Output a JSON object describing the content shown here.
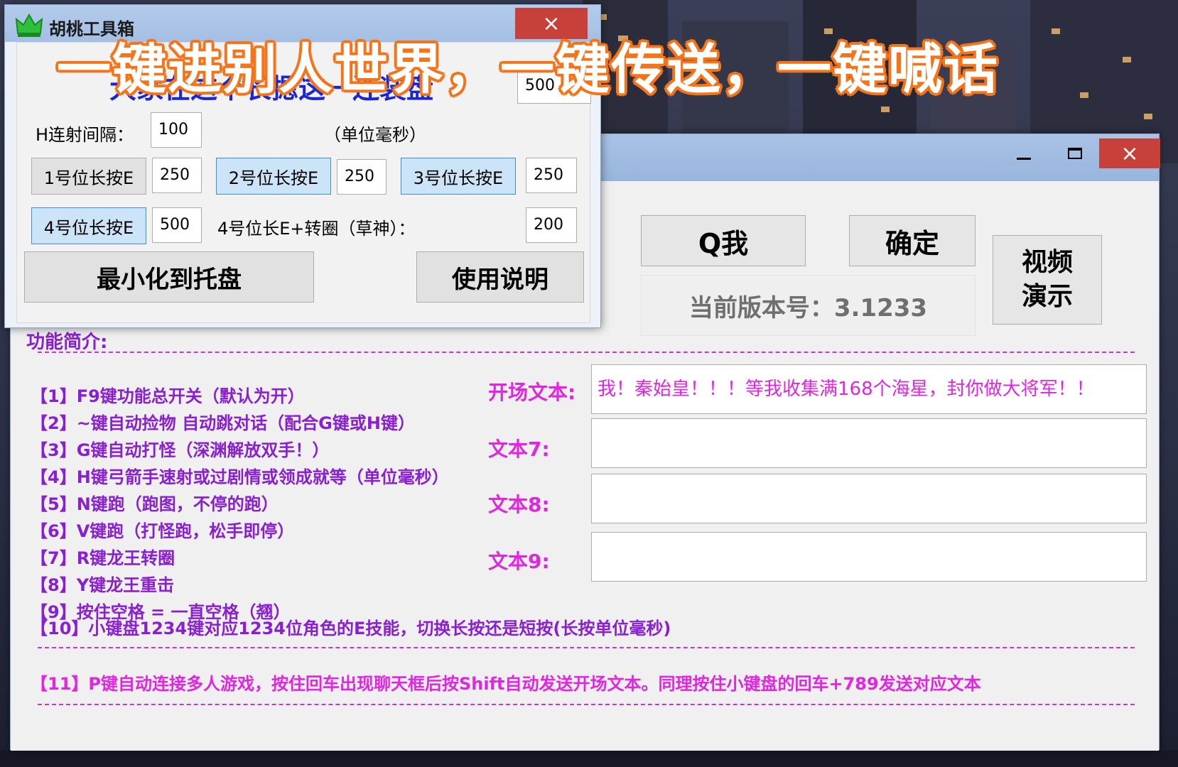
{
  "main_window": {
    "buttons": {
      "q_label": "Q我",
      "ok_label": "确定",
      "video_line1": "视频",
      "video_line2": "演示"
    },
    "version_text": "当前版本号：3.1233",
    "features_label": "功能简介:",
    "features": [
      "【1】F9键功能总开关（默认为开）",
      "【2】~键自动捡物 自动跳对话（配合G键或H键）",
      "【3】G键自动打怪（深渊解放双手！）",
      "【4】H键弓箭手速射或过剧情或领成就等（单位毫秒）",
      "【5】N键跑（跑图，不停的跑）",
      "【6】V键跑（打怪跑，松手即停）",
      "【7】R键龙王转圈",
      "【8】Y键龙王重击",
      "【9】按住空格 = 一直空格（翘）"
    ],
    "feature_10": "【10】小键盘1234键对应1234位角色的E技能，切换长按还是短按(长按单位毫秒)",
    "feature_11": "【11】P键自动连接多人游戏，按住回车出现聊天框后按Shift自动发送开场文本。同理按住小键盘的回车+789发送对应文本",
    "text_fields": [
      {
        "label": "开场文本:",
        "value": "我！秦始皇！！！等我收集满168个海星，封你做大将军！！"
      },
      {
        "label": "文本7:",
        "value": ""
      },
      {
        "label": "文本8:",
        "value": ""
      },
      {
        "label": "文本9:",
        "value": ""
      }
    ]
  },
  "small_window": {
    "title": "胡桃工具箱",
    "close_glyph": "×",
    "banner": "大家在这个长摁这一连装盘",
    "top_input": "500",
    "h_interval_label": "H连射间隔：",
    "h_interval_value": "100",
    "unit_label": "（单位毫秒）",
    "slots": [
      {
        "label": "1号位长按E",
        "value": "250",
        "active": false
      },
      {
        "label": "2号位长按E",
        "value": "250",
        "active": true
      },
      {
        "label": "3号位长按E",
        "value": "250",
        "active": true
      },
      {
        "label": "4号位长按E",
        "value": "500",
        "active": true
      }
    ],
    "slot4_spin_label": "4号位长E+转圈（草神）：",
    "slot4_spin_value": "200",
    "minimize_label": "最小化到托盘",
    "help_label": "使用说明"
  },
  "overlay_caption": "一键进别人世界，一键传送，一键喊话",
  "colors": {
    "feature_purple": "#8a1fd1",
    "feature_magenta": "#e026e0",
    "banner_blue": "#1c25d6",
    "caption_orange": "#f5741a",
    "close_red": "#c8403a"
  }
}
